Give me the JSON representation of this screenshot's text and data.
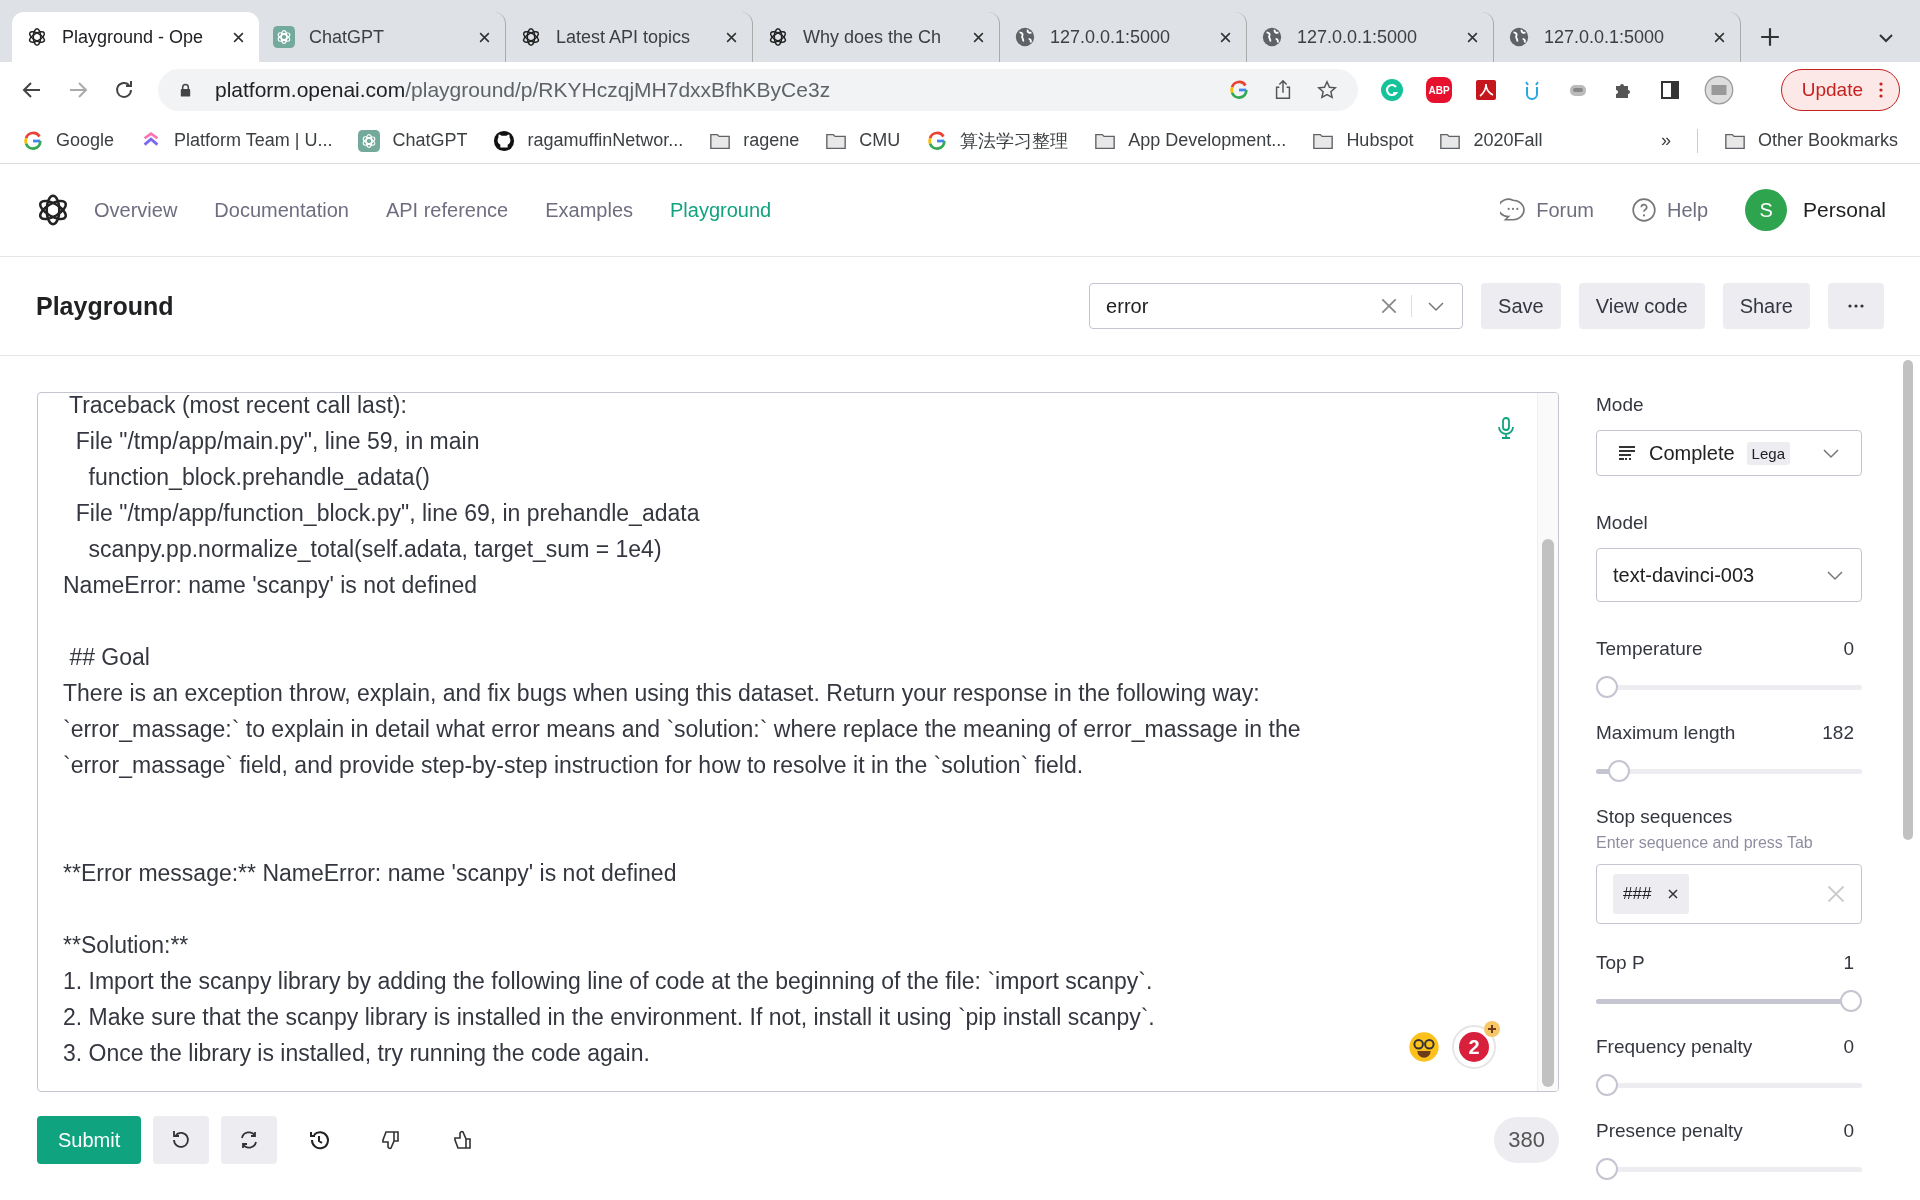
{
  "browser": {
    "tabs": [
      {
        "title": "Playground - Ope",
        "kind": "openai",
        "selected": true
      },
      {
        "title": "ChatGPT",
        "kind": "chatgpt",
        "selected": false
      },
      {
        "title": "Latest API topics",
        "kind": "openai",
        "selected": false
      },
      {
        "title": "Why does the Ch",
        "kind": "openai",
        "selected": false
      },
      {
        "title": "127.0.0.1:5000",
        "kind": "globe",
        "selected": false
      },
      {
        "title": "127.0.0.1:5000",
        "kind": "globe",
        "selected": false
      },
      {
        "title": "127.0.0.1:5000",
        "kind": "globe",
        "selected": false
      }
    ],
    "url_host": "platform.openai.com",
    "url_path": "/playground/p/RKYHczqjMH7dxxBfhKByCe3z",
    "extensions": [
      {
        "kind": "grammarly"
      },
      {
        "kind": "abp",
        "label": "ABP"
      },
      {
        "kind": "pdf"
      },
      {
        "kind": "owl"
      },
      {
        "kind": "robot"
      },
      {
        "kind": "puzzle"
      },
      {
        "kind": "sidepanel"
      },
      {
        "kind": "profile"
      }
    ],
    "update_button": "Update",
    "bookmarks": [
      {
        "label": "Google",
        "kind": "google"
      },
      {
        "label": "Platform Team | U...",
        "kind": "clickup"
      },
      {
        "label": "ChatGPT",
        "kind": "chatgpt"
      },
      {
        "label": "ragamuffinNetwor...",
        "kind": "github"
      },
      {
        "label": "ragene",
        "kind": "folder"
      },
      {
        "label": "CMU",
        "kind": "folder"
      },
      {
        "label": "算法学习整理",
        "kind": "google"
      },
      {
        "label": "App Development...",
        "kind": "folder"
      },
      {
        "label": "Hubspot",
        "kind": "folder"
      },
      {
        "label": "2020Fall",
        "kind": "folder"
      }
    ],
    "bookmarks_more": "»",
    "other_bookmarks": "Other Bookmarks"
  },
  "nav": {
    "links": [
      {
        "label": "Overview",
        "selected": false
      },
      {
        "label": "Documentation",
        "selected": false
      },
      {
        "label": "API reference",
        "selected": false
      },
      {
        "label": "Examples",
        "selected": false
      },
      {
        "label": "Playground",
        "selected": true
      }
    ],
    "forum": "Forum",
    "help": "Help",
    "avatar": "S",
    "account": "Personal"
  },
  "header": {
    "title": "Playground",
    "preset": "error",
    "buttons": [
      "Save",
      "View code",
      "Share"
    ]
  },
  "editor": {
    "lines": [
      " Traceback (most recent call last):",
      "  File \"/tmp/app/main.py\", line 59, in main",
      "    function_block.prehandle_adata()",
      "  File \"/tmp/app/function_block.py\", line 69, in prehandle_adata",
      "    scanpy.pp.normalize_total(self.adata, target_sum = 1e4)",
      "NameError: name 'scanpy' is not defined",
      {
        "text": " ## Goal",
        "kind": "spaced"
      },
      "There is an exception throw, explain, and fix bugs when using this dataset. Return your response in the following way:",
      "`error_massage:` to explain in detail what error means and `solution:` where replace the meaning of error_massage in the",
      "`error_massage` field, and provide step-by-step instruction for how to resolve it in the `solution` field.",
      {
        "text": "**Error message:** NameError: name 'scanpy' is not defined",
        "kind": "wide-spaced"
      },
      {
        "text": "**Solution:**",
        "kind": "spaced"
      },
      "1. Import the scanpy library by adding the following line of code at the beginning of the file: `import scanpy`.",
      "2. Make sure that the scanpy library is installed in the environment. If not, install it using `pip install scanpy`.",
      "3. Once the library is installed, try running the code again."
    ],
    "grammar_count": "2"
  },
  "actions": {
    "submit": "Submit",
    "tokens": "380"
  },
  "settings": {
    "mode_label": "Mode",
    "mode": "Complete",
    "mode_badge": "Lega",
    "model_label": "Model",
    "model": "text-davinci-003",
    "sliders_top": [
      {
        "name": "Temperature",
        "reading": "0",
        "level": 0
      },
      {
        "name": "Maximum length",
        "reading": "182",
        "level": 0.05
      }
    ],
    "stop_label": "Stop sequences",
    "stop_hint": "Enter sequence and press Tab",
    "stop_tags": [
      "###"
    ],
    "sliders_bottom": [
      {
        "name": "Top P",
        "reading": "1",
        "level": 1
      },
      {
        "name": "Frequency penalty",
        "reading": "0",
        "level": 0
      },
      {
        "name": "Presence penalty",
        "reading": "0",
        "level": 0
      }
    ]
  }
}
